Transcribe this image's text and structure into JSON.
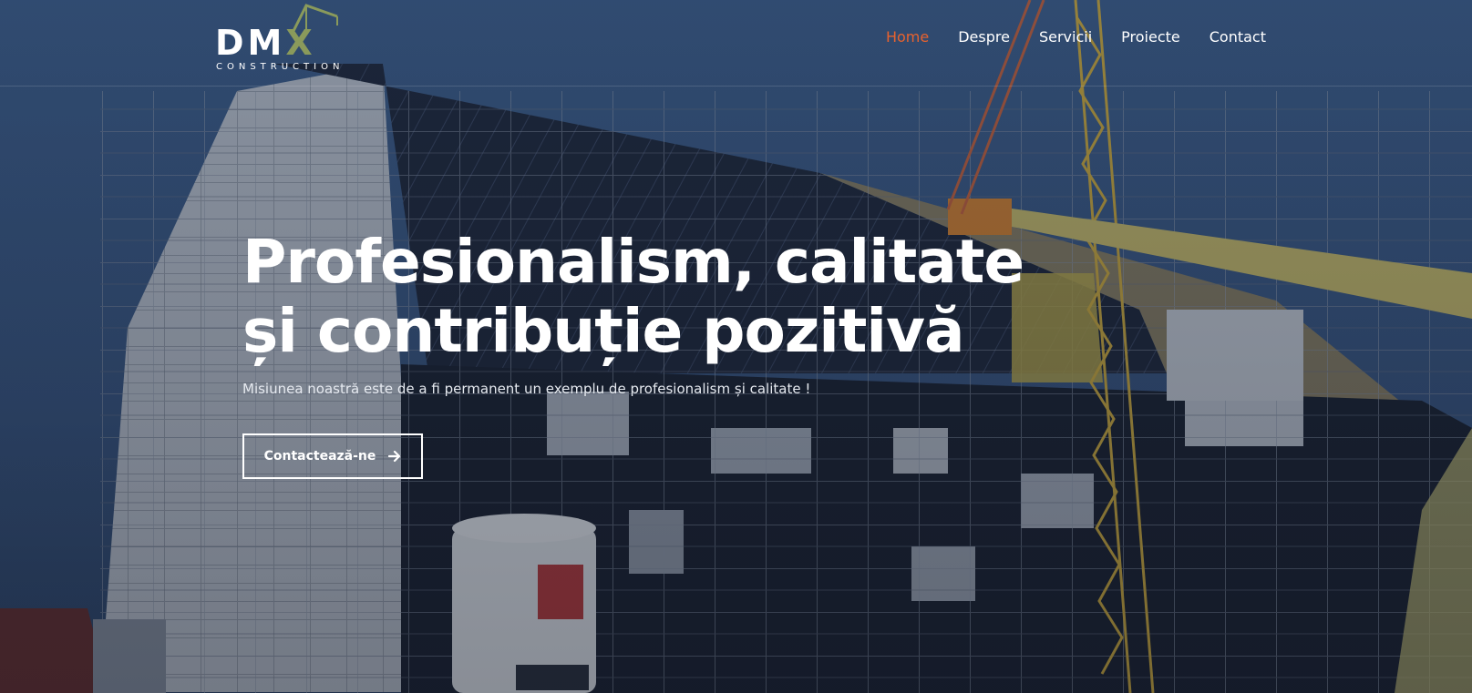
{
  "logo": {
    "name": "DMX",
    "subtitle": "CONSTRUCTION"
  },
  "nav": {
    "items": [
      {
        "label": "Home",
        "active": true
      },
      {
        "label": "Despre",
        "active": false
      },
      {
        "label": "Servicii",
        "active": false
      },
      {
        "label": "Proiecte",
        "active": false
      },
      {
        "label": "Contact",
        "active": false
      }
    ]
  },
  "hero": {
    "title_line1": "Profesionalism, calitate",
    "title_line2": "și contribuție pozitivă",
    "subtitle": "Misiunea noastră este de a fi permanent un exemplu de profesionalism și calitate !",
    "cta_label": "Contactează-ne",
    "cta_icon": "arrow-right-icon"
  },
  "colors": {
    "accent": "#e8622e",
    "logo_accent": "#8a9a5b",
    "text": "#ffffff"
  }
}
